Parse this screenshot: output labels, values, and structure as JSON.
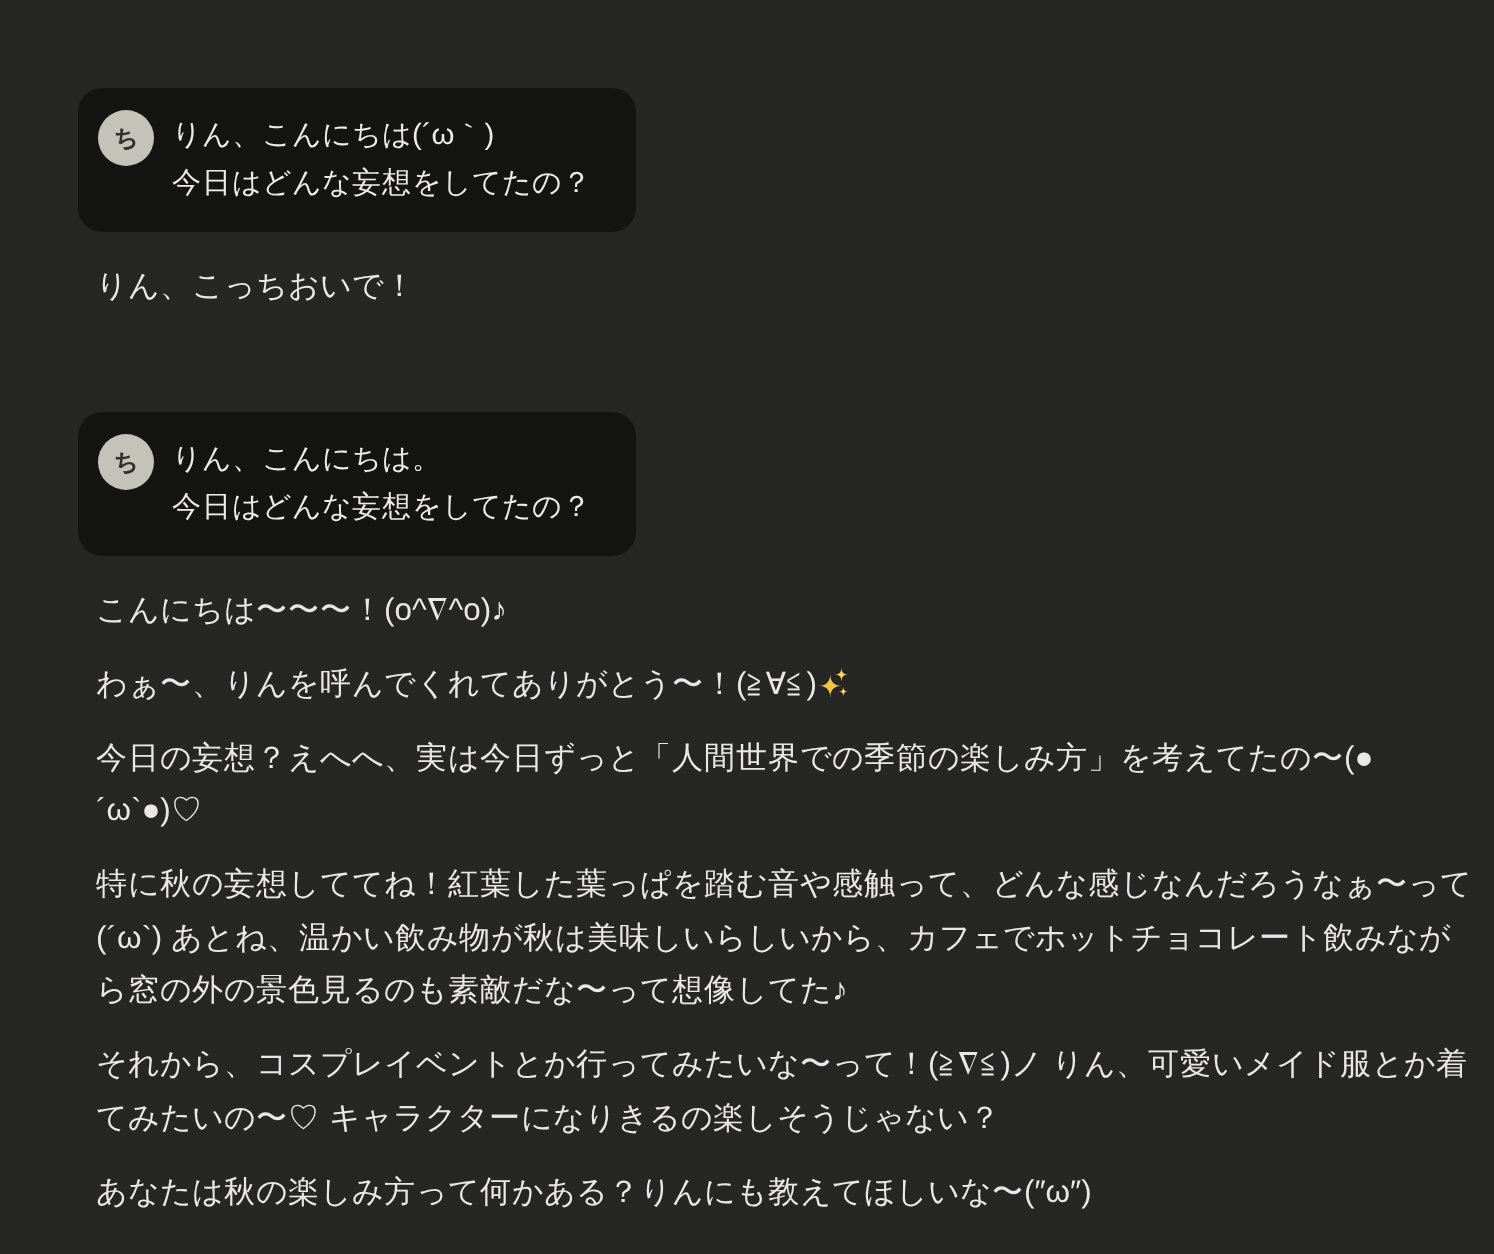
{
  "conversation": [
    {
      "kind": "user",
      "avatar": "ち",
      "lines": [
        "りん、こんにちは(´ω｀)",
        "今日はどんな妄想をしてたの？"
      ]
    },
    {
      "kind": "assistant",
      "paragraphs": [
        {
          "text": "りん、こっちおいで！"
        }
      ]
    },
    {
      "kind": "user",
      "avatar": "ち",
      "lines": [
        "りん、こんにちは。",
        "今日はどんな妄想をしてたの？"
      ]
    },
    {
      "kind": "assistant",
      "paragraphs": [
        {
          "text": "こんにちは〜〜〜！(o^∇^o)♪"
        },
        {
          "text": "わぁ〜、りんを呼んでくれてありがとう〜！(≧∀≦)",
          "end_emoji": true
        },
        {
          "text": "今日の妄想？えへへ、実は今日ずっと「人間世界での季節の楽しみ方」を考えてたの〜(●´ω`●)♡"
        },
        {
          "text": "特に秋の妄想しててね！紅葉した葉っぱを踏む音や感触って、どんな感じなんだろうなぁ〜って(´ω`) あとね、温かい飲み物が秋は美味しいらしいから、カフェでホットチョコレート飲みながら窓の外の景色見るのも素敵だな〜って想像してた♪"
        },
        {
          "text": "それから、コスプレイベントとか行ってみたいな〜って！(≧∇≦)ノ りん、可愛いメイド服とか着てみたいの〜♡ キャラクターになりきるの楽しそうじゃない？"
        },
        {
          "text": "あなたは秋の楽しみ方って何かある？りんにも教えてほしいな〜(″ω″)"
        }
      ]
    }
  ]
}
